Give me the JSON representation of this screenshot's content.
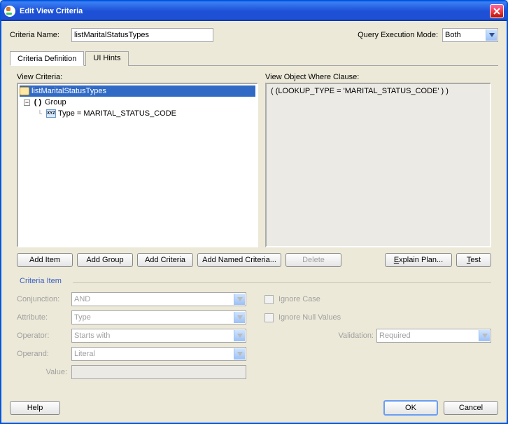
{
  "window": {
    "title": "Edit View Criteria"
  },
  "topform": {
    "criteria_name_label": "Criteria Name:",
    "criteria_name_value": "listMaritalStatusTypes",
    "exec_mode_label": "Query Execution Mode:",
    "exec_mode_value": "Both"
  },
  "tabs": {
    "definition": "Criteria Definition",
    "uihints": "UI Hints"
  },
  "left": {
    "label": "View Criteria:",
    "root": "listMaritalStatusTypes",
    "group": "Group",
    "item": "Type = MARITAL_STATUS_CODE"
  },
  "right": {
    "label": "View Object Where Clause:",
    "text": "( (LOOKUP_TYPE = 'MARITAL_STATUS_CODE' ) )"
  },
  "buttons": {
    "add_item": "Add Item",
    "add_group": "Add Group",
    "add_criteria": "Add Criteria",
    "add_named": "Add Named Criteria...",
    "delete": "Delete",
    "explain": "Explain Plan...",
    "test": "Test"
  },
  "criteria_item": {
    "legend": "Criteria Item",
    "conjunction_label": "Conjunction:",
    "conjunction_value": "AND",
    "attribute_label": "Attribute:",
    "attribute_value": "Type",
    "operator_label": "Operator:",
    "operator_value": "Starts with",
    "operand_label": "Operand:",
    "operand_value": "Literal",
    "value_label": "Value:",
    "ignore_case": "Ignore Case",
    "ignore_null": "Ignore Null Values",
    "validation_label": "Validation:",
    "validation_value": "Required"
  },
  "footer": {
    "help": "Help",
    "ok": "OK",
    "cancel": "Cancel"
  }
}
